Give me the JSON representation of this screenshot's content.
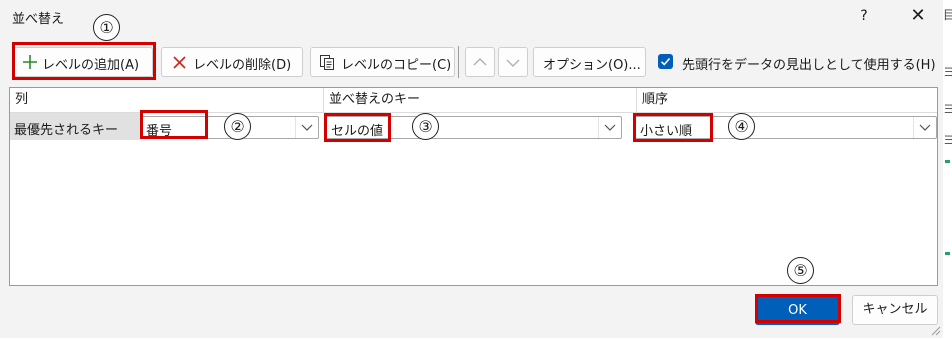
{
  "dialog": {
    "title": "並べ替え",
    "help": "?",
    "close": "✕"
  },
  "toolbar": {
    "add_level": "レベルの追加(A)",
    "delete_level": "レベルの削除(D)",
    "copy_level": "レベルのコピー(C)",
    "options": "オプション(O)...",
    "header_checkbox_label": "先頭行をデータの見出しとして使用する(H)",
    "header_checkbox_checked": true
  },
  "grid": {
    "headers": [
      "列",
      "並べ替えのキー",
      "順序"
    ],
    "row": {
      "label": "最優先されるキー",
      "column_value": "番号",
      "sort_on_value": "セルの値",
      "order_value": "小さい順"
    }
  },
  "footer": {
    "ok": "OK",
    "cancel": "キャンセル"
  },
  "callouts": [
    "①",
    "②",
    "③",
    "④",
    "⑤"
  ],
  "colors": {
    "highlight": "#d40000",
    "accent": "#005fb8",
    "add_icon": "#2d8a2d",
    "delete_icon": "#c42b1c"
  },
  "background_strip": [
    "目",
    "ヨ",
    "ヨ",
    "ヨ"
  ]
}
